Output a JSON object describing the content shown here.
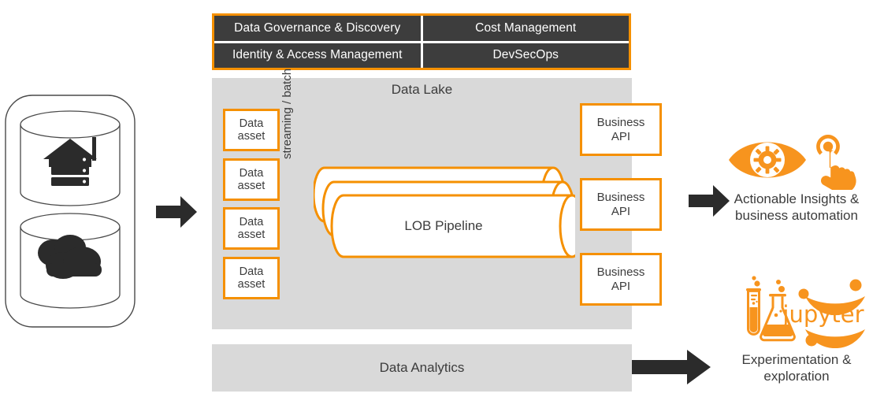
{
  "colors": {
    "orange": "#F59000",
    "dark_cell": "#3d3d3d",
    "panel_gray": "#d9d9d9",
    "text_dark": "#3c3c3c",
    "arrow_dark": "#2b2b2b",
    "white": "#ffffff"
  },
  "governance_header": {
    "cells": [
      {
        "label": "Data Governance & Discovery"
      },
      {
        "label": "Cost Management"
      },
      {
        "label": "Identity & Access Management"
      },
      {
        "label": "DevSecOps"
      }
    ]
  },
  "data_lake": {
    "title": "Data Lake",
    "data_assets": [
      {
        "line1": "Data",
        "line2": "asset"
      },
      {
        "line1": "Data",
        "line2": "asset"
      },
      {
        "line1": "Data",
        "line2": "asset"
      },
      {
        "line1": "Data",
        "line2": "asset"
      }
    ],
    "ingest_label": "streaming / batch",
    "pipeline": {
      "label": "LOB Pipeline",
      "cylinder_count": 3
    },
    "business_apis": [
      {
        "line1": "Business",
        "line2": "API"
      },
      {
        "line1": "Business",
        "line2": "API"
      },
      {
        "line1": "Business",
        "line2": "API"
      }
    ]
  },
  "data_analytics": {
    "title": "Data Analytics"
  },
  "sources": {
    "items": [
      {
        "icon": "on-premises-datacenter-icon"
      },
      {
        "icon": "cloud-icon"
      }
    ]
  },
  "outcomes": [
    {
      "id": "actionable-insights",
      "line1": "Actionable Insights &",
      "line2": "business automation",
      "icons": [
        "eye-gear-icon",
        "tap-hand-icon"
      ]
    },
    {
      "id": "experimentation",
      "line1": "Experimentation &",
      "line2": "exploration",
      "icons": [
        "test-tube-icon",
        "flask-icon",
        "jupyter-logo-icon"
      ],
      "jupyter_wordmark": "jupyter"
    }
  ],
  "arrows": [
    {
      "id": "sources-to-lake"
    },
    {
      "id": "apis-to-insights"
    },
    {
      "id": "analytics-to-experimentation"
    }
  ]
}
